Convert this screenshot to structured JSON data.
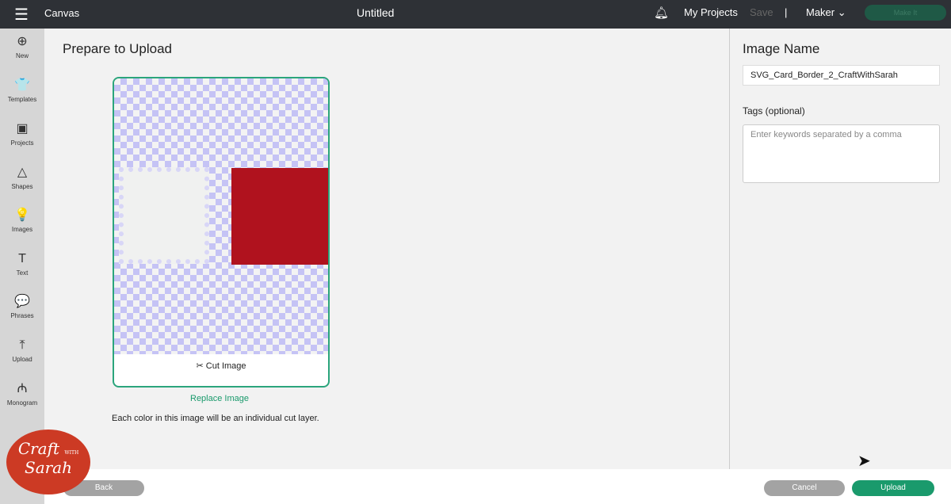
{
  "topbar": {
    "menu_icon": "hamburger-icon",
    "app": "Canvas",
    "title": "Untitled",
    "bell_icon": "bell-icon",
    "my_projects": "My Projects",
    "save": "Save",
    "separator": "|",
    "machine": "Maker",
    "make_it": "Make It"
  },
  "sidebar": {
    "items": [
      {
        "label": "New",
        "icon": "⊕"
      },
      {
        "label": "Templates",
        "icon": "👕"
      },
      {
        "label": "Projects",
        "icon": "▣"
      },
      {
        "label": "Shapes",
        "icon": "△"
      },
      {
        "label": "Images",
        "icon": "💡"
      },
      {
        "label": "Text",
        "icon": "T"
      },
      {
        "label": "Phrases",
        "icon": "💬"
      },
      {
        "label": "Upload",
        "icon": "⤒"
      },
      {
        "label": "Monogram",
        "icon": "₼"
      }
    ]
  },
  "main": {
    "title": "Prepare to Upload",
    "cut_image": "Cut Image",
    "replace": "Replace Image",
    "note": "Each color in this image will be an individual cut layer."
  },
  "right": {
    "image_name_label": "Image Name",
    "image_name_value": "SVG_Card_Border_2_CraftWithSarah",
    "tags_label": "Tags (optional)",
    "tags_placeholder": "Enter keywords separated by a comma"
  },
  "footer": {
    "back": "Back",
    "cancel": "Cancel",
    "upload": "Upload"
  },
  "watermark": {
    "line1": "Craft",
    "with": "WITH",
    "line2": "Sarah"
  },
  "colors": {
    "accent": "#1a9a6c",
    "red": "#b0121e",
    "checker": "#c5c3f5"
  }
}
